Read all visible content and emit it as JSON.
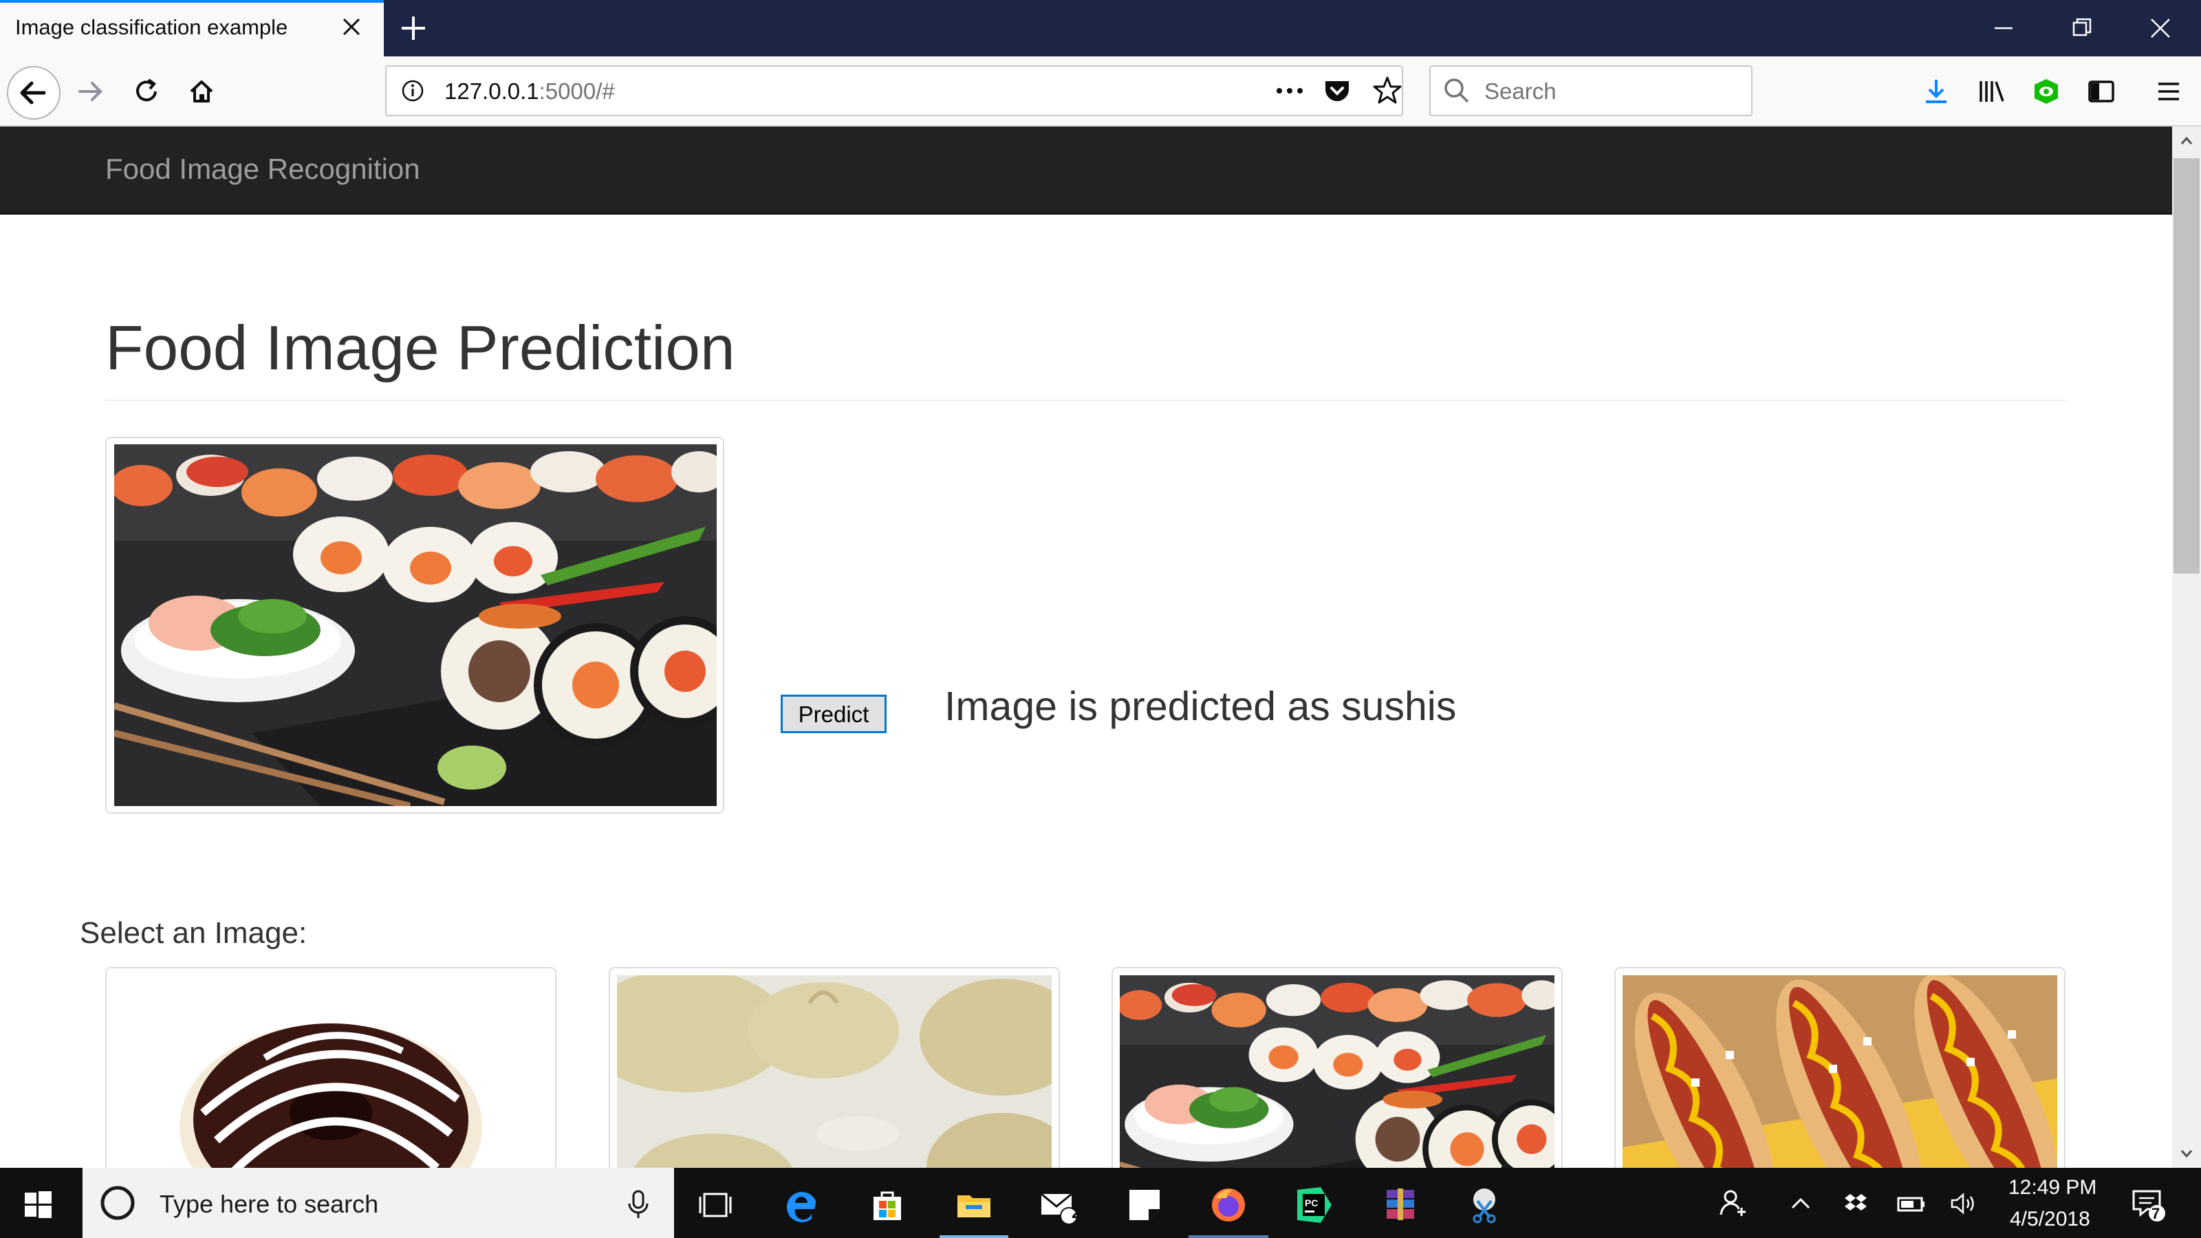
{
  "browser": {
    "tab_title": "Image classification example",
    "url_host": "127.0.0.1",
    "url_path": ":5000/#",
    "search_placeholder": "Search"
  },
  "site": {
    "brand": "Food Image Recognition",
    "heading": "Food Image Prediction",
    "predict_button": "Predict",
    "prediction": "Image is predicted as sushis",
    "select_label": "Select an Image:"
  },
  "thumbnails": [
    {
      "subject": "donut-image"
    },
    {
      "subject": "dumplings-image"
    },
    {
      "subject": "sushi-image"
    },
    {
      "subject": "hot-dog-image"
    }
  ],
  "taskbar": {
    "search_placeholder": "Type here to search",
    "mail_badge": "2",
    "notification_badge": "7",
    "time": "12:49 PM",
    "date": "4/5/2018"
  },
  "colors": {
    "tab_strip": "#1c2544",
    "active_tab_accent": "#0a84ff",
    "site_navbar": "#222222",
    "predict_button_border": "#0078d7",
    "taskbar": "#101010"
  }
}
